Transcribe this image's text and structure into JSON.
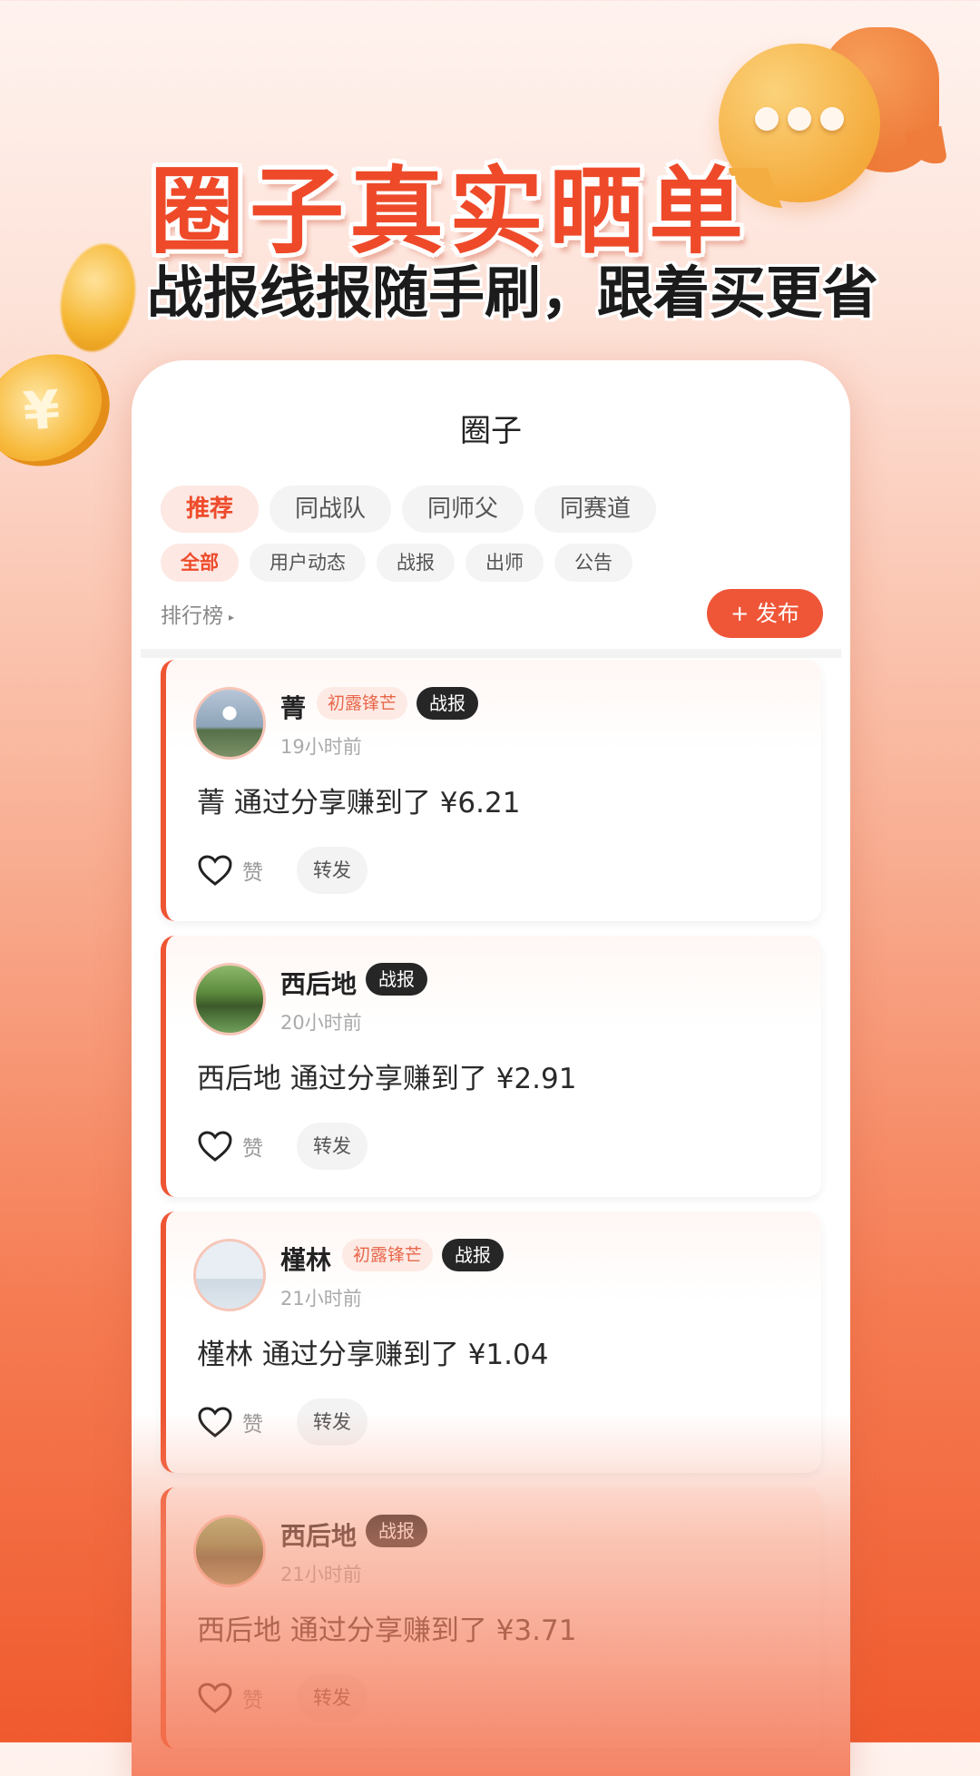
{
  "promo": {
    "headline": "圈子真实晒单",
    "subline": "战报线报随手刷，跟着买更省",
    "coin_symbol": "¥"
  },
  "app": {
    "title": "圈子",
    "tabs": [
      {
        "label": "推荐",
        "active": true
      },
      {
        "label": "同战队",
        "active": false
      },
      {
        "label": "同师父",
        "active": false
      },
      {
        "label": "同赛道",
        "active": false
      }
    ],
    "filters": [
      {
        "label": "全部",
        "active": true
      },
      {
        "label": "用户动态",
        "active": false
      },
      {
        "label": "战报",
        "active": false
      },
      {
        "label": "出师",
        "active": false
      },
      {
        "label": "公告",
        "active": false
      }
    ],
    "ranking_label": "排行榜",
    "ranking_arrow": "▸",
    "publish_label": "+ 发布"
  },
  "posts": [
    {
      "name": "菁",
      "level": "初露锋芒",
      "tag": "战报",
      "time": "19小时前",
      "content": "菁 通过分享赚到了 ¥6.21",
      "like_label": "赞",
      "forward_label": "转发"
    },
    {
      "name": "西后地",
      "level": "",
      "tag": "战报",
      "time": "20小时前",
      "content": "西后地 通过分享赚到了 ¥2.91",
      "like_label": "赞",
      "forward_label": "转发"
    },
    {
      "name": "槿林",
      "level": "初露锋芒",
      "tag": "战报",
      "time": "21小时前",
      "content": "槿林 通过分享赚到了 ¥1.04",
      "like_label": "赞",
      "forward_label": "转发"
    },
    {
      "name": "西后地",
      "level": "",
      "tag": "战报",
      "time": "21小时前",
      "content": "西后地 通过分享赚到了 ¥3.71",
      "like_label": "赞",
      "forward_label": "转发"
    }
  ],
  "colors": {
    "accent": "#ee4b2b",
    "tag_bg": "#262626"
  }
}
